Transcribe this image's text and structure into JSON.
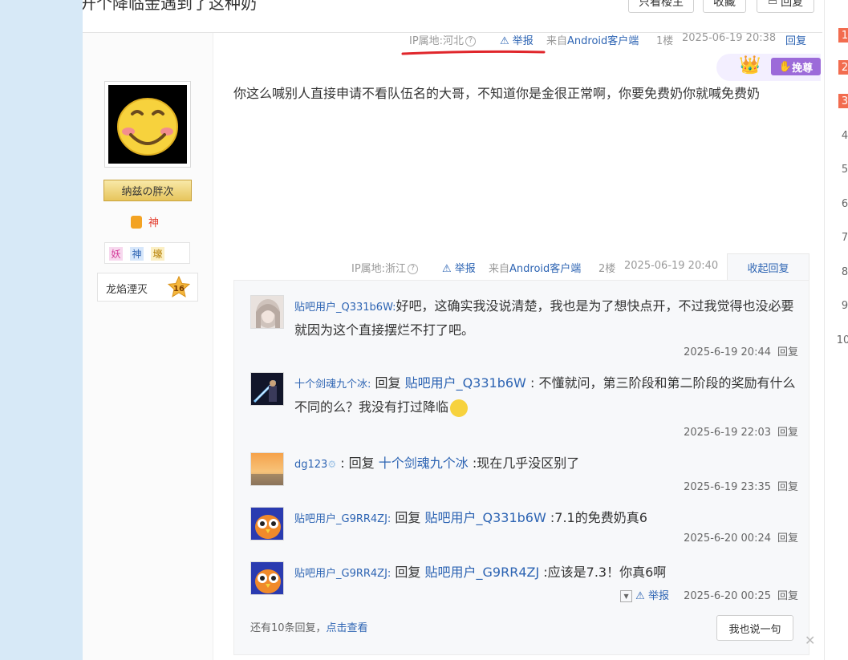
{
  "header": {
    "title": "开个降临金遇到了这种奶",
    "buttons": [
      "只看楼主",
      "收藏",
      "回复"
    ]
  },
  "author": {
    "nameplate": "纳兹の胖次",
    "title_badge": "神",
    "tags": [
      "妖",
      "神",
      "壕"
    ],
    "level_name": "龙焰湮灭",
    "level": "16"
  },
  "floor1": {
    "ip": "IP属地:河北",
    "report": "举报",
    "source": "来自Android客户端",
    "floor": "1楼",
    "time": "2025-06-19 20:38",
    "reply": "回复",
    "vip": "挽尊",
    "content": "你这么喊别人直接申请不看队伍名的大哥，不知道你是金很正常啊，你要免费奶你就喊免费奶"
  },
  "floor2": {
    "ip": "IP属地:浙江",
    "report": "举报",
    "source": "来自Android客户端",
    "floor": "2楼",
    "time": "2025-06-19 20:40",
    "fold": "收起回复"
  },
  "comments": [
    {
      "user": "贴吧用户_Q331b6W:",
      "prefix": "",
      "ref": "",
      "text": "好吧，这确实我没说清楚，我也是为了想快点开，不过我觉得也没必要就因为这个直接摆烂不打了吧。",
      "time": "2025-6-19 20:44",
      "reply": "回复"
    },
    {
      "user": "十个剑魂九个冰:",
      "prefix": "回复 ",
      "ref": "贴吧用户_Q331b6W",
      "text": " : 不懂就问，第三阶段和第二阶段的奖励有什么不同的么？我没有打过降临",
      "time": "2025-6-19 22:03",
      "reply": "回复"
    },
    {
      "user": "dg123",
      "prefix": ": 回复 ",
      "ref": "十个剑魂九个冰",
      "text": " :现在几乎没区别了",
      "time": "2025-6-19 23:35",
      "reply": "回复"
    },
    {
      "user": "贴吧用户_G9RR4ZJ:",
      "prefix": "回复 ",
      "ref": "贴吧用户_Q331b6W",
      "text": " :7.1的免费奶真6",
      "time": "2025-6-20 00:24",
      "reply": "回复"
    },
    {
      "user": "贴吧用户_G9RR4ZJ:",
      "prefix": "回复 ",
      "ref": "贴吧用户_G9RR4ZJ",
      "text": " :应该是7.3！你真6啊",
      "time": "2025-6-20 00:25",
      "reply": "回复",
      "report": "举报"
    }
  ],
  "comments_footer": {
    "more_prefix": "还有10条回复，",
    "more_link": "点击查看",
    "say_button": "我也说一句"
  },
  "rail_ranks": [
    "1",
    "2",
    "3",
    "4",
    "5",
    "6",
    "7",
    "8",
    "9",
    "10"
  ]
}
